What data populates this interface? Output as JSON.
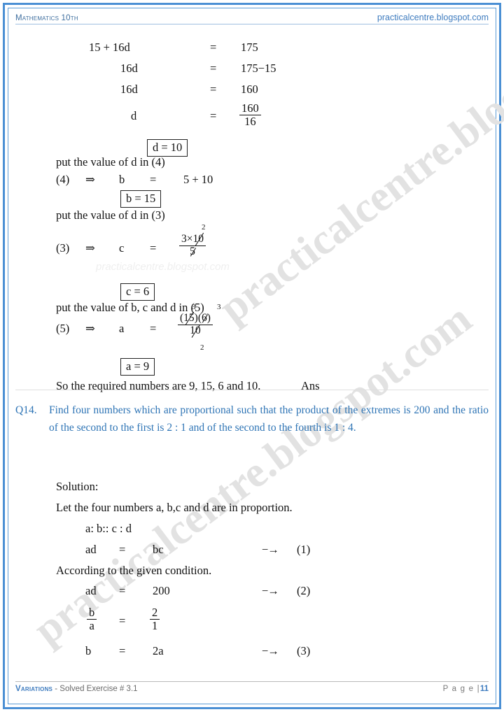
{
  "page": {
    "header": {
      "left": "Mathematics 10th",
      "right": "practicalcentre.blogspot.com"
    },
    "footer": {
      "title": "Variations",
      "subtitle": "- Solved Exercise # 3.1",
      "page_label": "P a g e |",
      "page_number": "11"
    },
    "watermark": {
      "diagonal": "practicalcentre.blogspot.com",
      "flat": "practicalcentre.blogspot.com"
    },
    "colors": {
      "border": "#4a8fd4",
      "accent": "#2e74b5",
      "header_link": "#3f7cbf",
      "text": "#111111",
      "watermark": "#e2e2e2"
    }
  },
  "solution_top": {
    "eq1": {
      "lhs": "15 + 16d",
      "eq": "=",
      "rhs": "175"
    },
    "eq2": {
      "lhs": "16d",
      "eq": "=",
      "rhs": "175−15"
    },
    "eq3": {
      "lhs": "16d",
      "eq": "=",
      "rhs": "160"
    },
    "eq4": {
      "lhs": "d",
      "eq": "=",
      "num": "160",
      "den": "16"
    },
    "box_d": "d = 10",
    "note1": "put the value of d in (4)",
    "line_b": {
      "ref": "(4)",
      "arrow": "⇒",
      "var": "b",
      "eq": "=",
      "val": "5 + 10"
    },
    "box_b": "b = 15",
    "note2": "put the value of d in (3)",
    "line_c": {
      "ref": "(3)",
      "arrow": "⇒",
      "var": "c",
      "eq": "=",
      "num_a": "3×",
      "num_cancel": "10",
      "num_sup": "2",
      "den_cancel": "5"
    },
    "box_c": "c = 6",
    "note3": "put the value of b, c and d in (5)",
    "line_a": {
      "ref": "(5)",
      "arrow": "⇒",
      "var": "a",
      "eq": "=",
      "num_open": "(",
      "num_c1": "15",
      "num_mid": ")(",
      "num_c2": "6",
      "num_close": ")",
      "sup1": "3",
      "sup2": "3",
      "den_cancel": "10",
      "den_sup": "2"
    },
    "box_a": "a = 9",
    "conclusion": "So the required numbers are 9, 15, 6 and 10.",
    "ans": "Ans"
  },
  "question14": {
    "number": "Q14.",
    "text": "Find four numbers which are proportional such that the product of the extremes is 200 and the ratio of the second to the first is 2 : 1 and of the second to the fourth is 1 : 4."
  },
  "solution14": {
    "solution_label": "Solution:",
    "let_line": "Let the four numbers a, b,c and d are in proportion.",
    "prop_line": "a: b:: c : d",
    "eq1": {
      "lhs": "ad",
      "eq": "=",
      "rhs": "bc",
      "arrow": "−→",
      "ref": "(1)"
    },
    "cond_line": "According to the given condition.",
    "eq2": {
      "lhs": "ad",
      "eq": "=",
      "rhs": "200",
      "arrow": "−→",
      "ref": "(2)"
    },
    "eq3": {
      "num_l": "b",
      "den_l": "a",
      "eq": "=",
      "num_r": "2",
      "den_r": "1"
    },
    "eq4": {
      "lhs": "b",
      "eq": "=",
      "rhs": "2a",
      "arrow": "−→",
      "ref": "(3)"
    }
  }
}
